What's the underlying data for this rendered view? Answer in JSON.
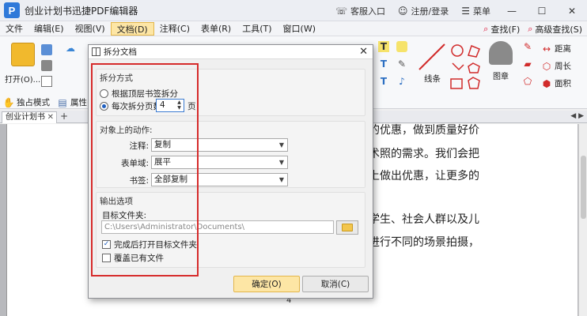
{
  "window": {
    "title": "创业计划书迅捷PDF编辑器",
    "service": "客服入口",
    "login": "注册/登录",
    "menu": "菜单"
  },
  "menubar": {
    "items": [
      "文件",
      "编辑(E)",
      "视图(V)",
      "文档(D)",
      "注释(C)",
      "表单(R)",
      "工具(T)",
      "窗口(W)"
    ],
    "active": "文档(D)",
    "find": "查找(F)",
    "advanced_find": "高级查找(S)"
  },
  "ribbon": {
    "open": "打开(O)...",
    "solo_mode": "独占模式",
    "properties": "属性(",
    "line": "线条",
    "stamp": "图章",
    "distance": "距离",
    "perimeter": "周长",
    "area": "面积"
  },
  "tabs": {
    "doc_tab": "创业计划书",
    "add": "+"
  },
  "document": {
    "lines": [
      "的优惠，做到质量好价",
      "术照的需求。我们会把",
      "上做出优惠，让更多的",
      "学生、社会人群以及儿",
      "进行不同的场景拍摄，"
    ],
    "page_number": "4"
  },
  "dialog": {
    "title": "拆分文档",
    "split_method": {
      "title": "拆分方式",
      "opt_bookmark": "根据顶层书签拆分",
      "opt_pages": "每次拆分页数",
      "pages_value": "4",
      "pages_unit": "页",
      "selected": "opt_pages"
    },
    "actions": {
      "title": "对象上的动作:",
      "annotations_label": "注释:",
      "annotations_value": "复制",
      "forms_label": "表单域:",
      "forms_value": "展平",
      "bookmarks_label": "书签:",
      "bookmarks_value": "全部复制"
    },
    "output": {
      "title": "输出选项",
      "folder_label": "目标文件夹:",
      "folder_value": "C:\\Users\\Administrator\\Documents\\",
      "open_after": "完成后打开目标文件夹",
      "open_after_checked": true,
      "overwrite": "覆盖已有文件",
      "overwrite_checked": false
    },
    "ok": "确定(O)",
    "cancel": "取消(C)"
  },
  "colors": {
    "accent": "#fde6a5",
    "highlight_box": "#d62b2b",
    "brand": "#2f79d9"
  }
}
